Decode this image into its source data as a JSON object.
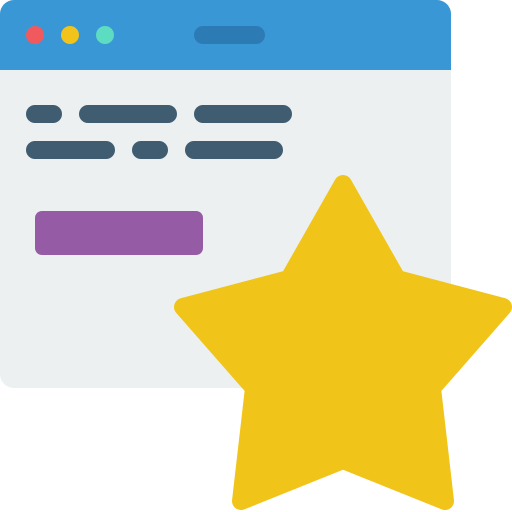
{
  "window": {
    "title_bar": {
      "color": "#3A97D6",
      "traffic_lights": [
        {
          "name": "close",
          "color": "#F05A5F"
        },
        {
          "name": "minimize",
          "color": "#F2C31B"
        },
        {
          "name": "maximize",
          "color": "#5CDCC0"
        }
      ],
      "address_pill_color": "#2C7BB5"
    },
    "content": {
      "background": "#ECF0F1",
      "text_line_color": "#3F5C70",
      "button_color": "#955BA5"
    }
  },
  "favorite": {
    "icon": "star-icon",
    "color": "#F0C419"
  }
}
